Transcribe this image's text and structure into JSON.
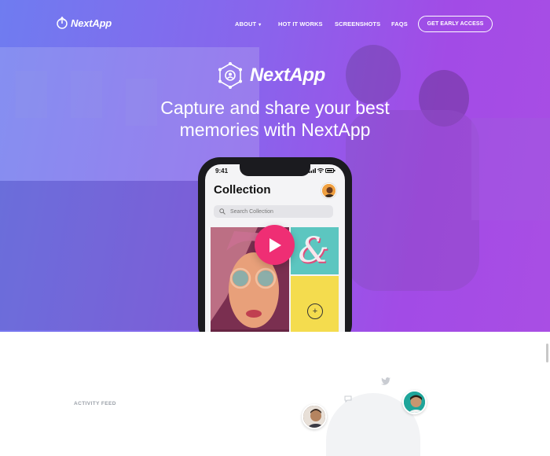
{
  "nav": {
    "logo_text": "NextApp",
    "items": [
      {
        "label": "ABOUT"
      },
      {
        "label": "HOT IT WORKS"
      },
      {
        "label": "SCREENSHOTS"
      },
      {
        "label": "FAQS"
      }
    ],
    "cta_label": "GET EARLY ACCESS"
  },
  "hero": {
    "brand_text": "NextApp",
    "headline_line1": "Capture and share your best",
    "headline_line2": "memories with NextApp"
  },
  "phone": {
    "time": "9:41",
    "title": "Collection",
    "search_placeholder": "Search Collection",
    "amp_glyph": "&",
    "add_glyph": "+"
  },
  "feed": {
    "section_label": "ACTIVITY FEED"
  },
  "colors": {
    "gradient_start": "#6f7cf0",
    "gradient_end": "#a94ee4",
    "play_button": "#ef2e74",
    "tile_teal": "#5cc6c0",
    "tile_yellow": "#f4dc4e"
  },
  "icons": [
    "nextapp-logo-icon",
    "caret-down-icon",
    "nextapp-brand-icon",
    "play-icon",
    "search-icon",
    "plus-icon",
    "twitter-icon",
    "chat-icon",
    "signal-icon",
    "wifi-icon",
    "battery-icon"
  ]
}
